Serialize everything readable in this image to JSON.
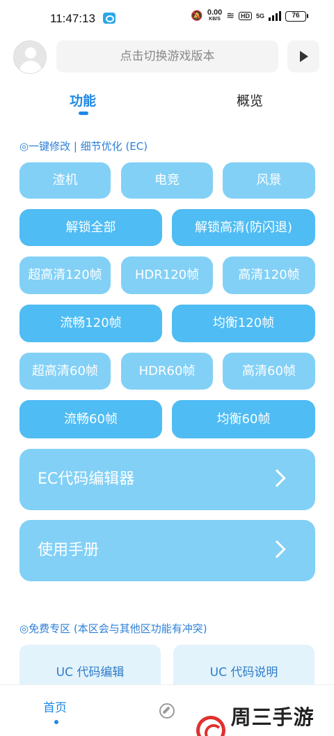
{
  "status_bar": {
    "time": "11:47:13",
    "speed_value": "0.00",
    "speed_unit": "KB/S",
    "hd": "HD",
    "network": "5G",
    "battery": "76"
  },
  "header": {
    "version_placeholder": "点击切换游戏版本"
  },
  "tabs": [
    {
      "label": "功能",
      "active": true
    },
    {
      "label": "概览",
      "active": false
    }
  ],
  "section1": {
    "title": "◎一键修改 | 细节优化 (EC)",
    "buttons": [
      "渣机",
      "电竞",
      "风景",
      "解锁全部",
      "解锁高清(防闪退)",
      "超高清120帧",
      "HDR120帧",
      "高清120帧",
      "流畅120帧",
      "均衡120帧",
      "超高清60帧",
      "HDR60帧",
      "高清60帧",
      "流畅60帧",
      "均衡60帧"
    ],
    "wide_buttons": [
      "EC代码编辑器",
      "使用手册"
    ]
  },
  "section2": {
    "title": "◎免费专区 (本区会与其他区功能有冲突)",
    "buttons": [
      "UC 代码编辑",
      "UC 代码说明"
    ]
  },
  "bottom_nav": {
    "home": "首页",
    "discover_icon": "compass-icon"
  },
  "watermark": {
    "text": "周三手游网"
  },
  "colors": {
    "accent": "#1e88e5",
    "button_light": "#82d0f6",
    "button_dark": "#4fbcf3",
    "free_bg": "#e2f3fc"
  }
}
